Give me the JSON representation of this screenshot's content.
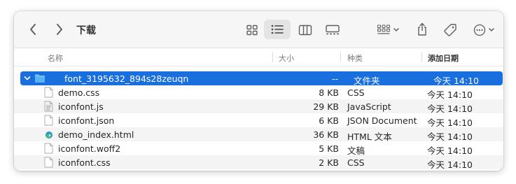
{
  "toolbar": {
    "title": "下载",
    "icons": [
      "chevron-left-icon",
      "chevron-right-icon",
      "grid-view-icon",
      "list-view-icon",
      "column-view-icon",
      "gallery-view-icon",
      "group-icon",
      "share-icon",
      "tag-icon",
      "more-icon"
    ]
  },
  "columns": {
    "name": "名称",
    "size": "大小",
    "kind": "种类",
    "date": "添加日期"
  },
  "folder": {
    "name": "font_3195632_894s28zeuqn",
    "size": "--",
    "kind": "文件夹",
    "date": "今天 14:10"
  },
  "files": [
    {
      "name": "demo.css",
      "size": "8 KB",
      "kind": "CSS",
      "date": "今天 14:10",
      "icon": "document-icon"
    },
    {
      "name": "iconfont.js",
      "size": "29 KB",
      "kind": "JavaScript",
      "date": "今天 14:10",
      "icon": "script-icon"
    },
    {
      "name": "iconfont.json",
      "size": "6 KB",
      "kind": "JSON Document",
      "date": "今天 14:10",
      "icon": "document-icon"
    },
    {
      "name": "demo_index.html",
      "size": "36 KB",
      "kind": "HTML 文本",
      "date": "今天 14:10",
      "icon": "edge-html-icon"
    },
    {
      "name": "iconfont.woff2",
      "size": "5 KB",
      "kind": "文稿",
      "date": "今天 14:10",
      "icon": "document-icon"
    },
    {
      "name": "iconfont.css",
      "size": "2 KB",
      "kind": "CSS",
      "date": "今天 14:10",
      "icon": "document-icon"
    }
  ],
  "colors": {
    "selection": "#1a6fde",
    "folder": "#5ab1f4"
  }
}
